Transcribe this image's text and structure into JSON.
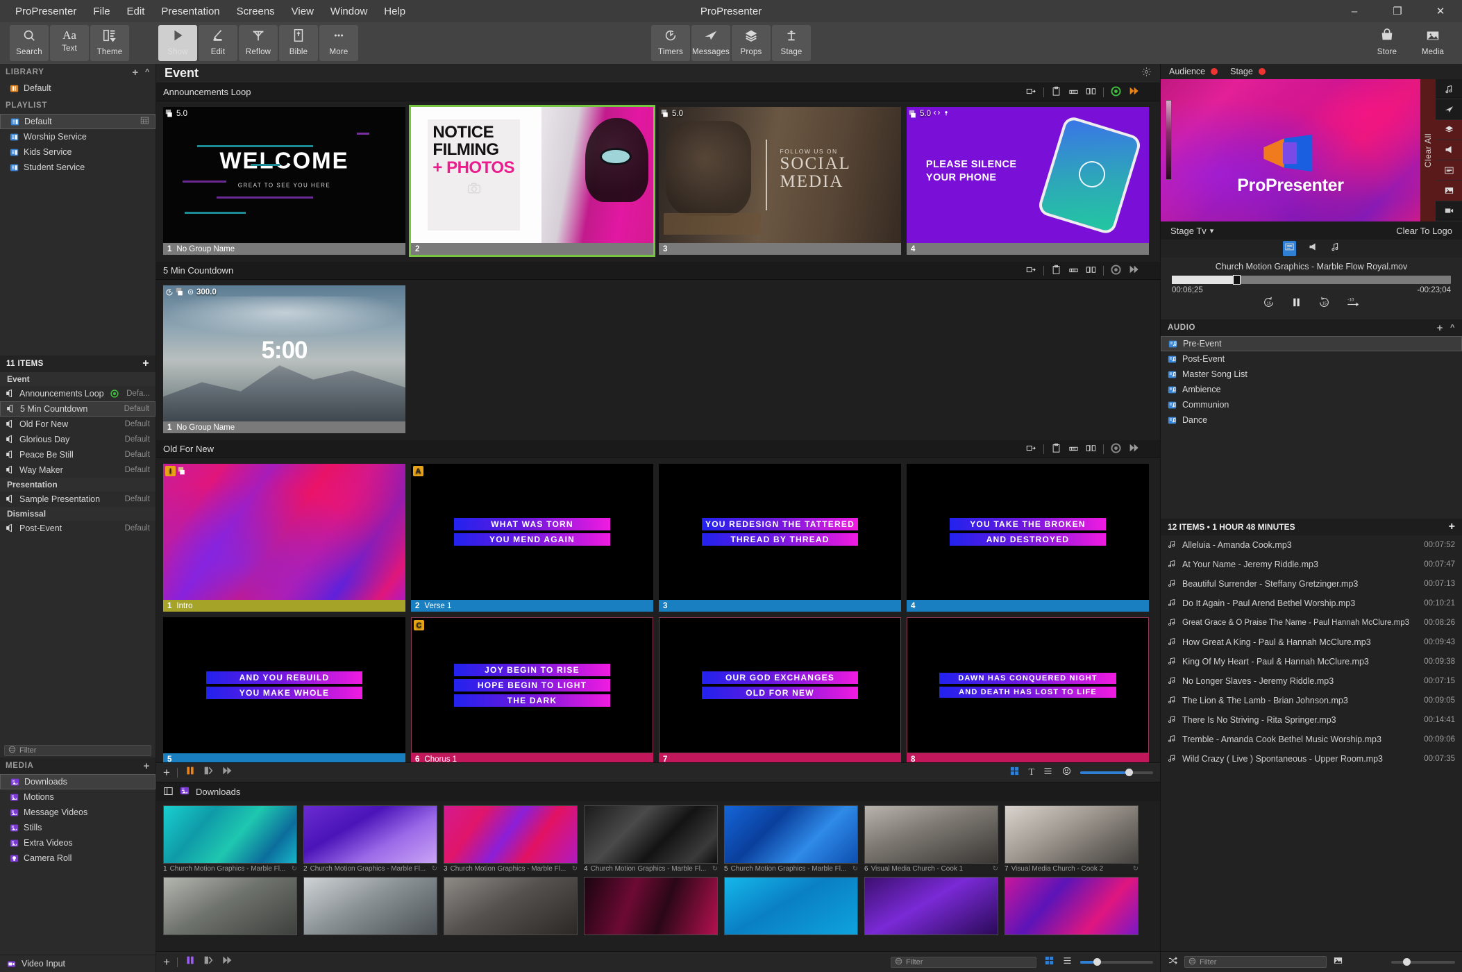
{
  "window": {
    "title": "ProPresenter",
    "menus": [
      "ProPresenter",
      "File",
      "Edit",
      "Presentation",
      "Screens",
      "View",
      "Window",
      "Help"
    ],
    "controls": {
      "minimize": "–",
      "maximize": "❐",
      "close": "✕"
    }
  },
  "toolbar": {
    "left": [
      {
        "label": "Search",
        "icon": "search-icon"
      },
      {
        "label": "Text",
        "icon": "text-icon"
      },
      {
        "label": "Theme",
        "icon": "theme-icon"
      }
    ],
    "middle": [
      {
        "label": "Show",
        "icon": "play-icon",
        "active": true
      },
      {
        "label": "Edit",
        "icon": "pencil-icon"
      },
      {
        "label": "Reflow",
        "icon": "reflow-icon"
      },
      {
        "label": "Bible",
        "icon": "bible-icon"
      },
      {
        "label": "More",
        "icon": "ellipsis-icon"
      }
    ],
    "right_group": [
      {
        "label": "Timers",
        "icon": "timer-icon"
      },
      {
        "label": "Messages",
        "icon": "send-icon"
      },
      {
        "label": "Props",
        "icon": "layers-icon"
      },
      {
        "label": "Stage",
        "icon": "stage-icon"
      }
    ],
    "far_right": [
      {
        "label": "Store",
        "icon": "store-icon"
      },
      {
        "label": "Media",
        "icon": "media-icon"
      }
    ]
  },
  "sidebar": {
    "library": {
      "title": "LIBRARY",
      "items": [
        {
          "label": "Default",
          "icon": "library-icon"
        }
      ]
    },
    "playlist": {
      "title": "PLAYLIST",
      "items": [
        {
          "label": "Default",
          "icon": "playlist-icon",
          "selected": true,
          "trailing_icon": "grid-icon"
        },
        {
          "label": "Worship Service",
          "icon": "playlist-icon"
        },
        {
          "label": "Kids Service",
          "icon": "playlist-icon"
        },
        {
          "label": "Student Service",
          "icon": "playlist-icon"
        }
      ]
    },
    "filter_placeholder": "Filter",
    "items_header": "11 ITEMS",
    "groups": [
      {
        "name": "Event",
        "items": [
          {
            "label": "Announcements Loop",
            "theme": "Defa...",
            "live": true
          },
          {
            "label": "5 Min Countdown",
            "theme": "Default",
            "selected": true
          },
          {
            "label": "Old For New",
            "theme": "Default"
          },
          {
            "label": "Glorious Day",
            "theme": "Default"
          },
          {
            "label": "Peace Be Still",
            "theme": "Default"
          },
          {
            "label": "Way Maker",
            "theme": "Default"
          }
        ]
      },
      {
        "name": "Presentation",
        "items": [
          {
            "label": "Sample Presentation",
            "theme": "Default"
          }
        ]
      },
      {
        "name": "Dismissal",
        "items": [
          {
            "label": "Post-Event",
            "theme": "Default"
          }
        ]
      }
    ],
    "media": {
      "title": "MEDIA",
      "items": [
        {
          "label": "Downloads",
          "icon": "media-folder-icon",
          "selected": true
        },
        {
          "label": "Motions",
          "icon": "media-folder-icon"
        },
        {
          "label": "Message Videos",
          "icon": "media-folder-icon"
        },
        {
          "label": "Stills",
          "icon": "media-folder-icon"
        },
        {
          "label": "Extra Videos",
          "icon": "media-folder-icon"
        },
        {
          "label": "Camera Roll",
          "icon": "camera-roll-icon"
        }
      ]
    },
    "video_input": "Video Input"
  },
  "main": {
    "title": "Event",
    "presentations": [
      {
        "name": "Announcements Loop",
        "slides": [
          {
            "num": "1",
            "label": "No Group Name",
            "timer": "5.0",
            "kind": "welcome",
            "foot_color": "#7a7a7a"
          },
          {
            "num": "2",
            "label": "",
            "kind": "notice",
            "selected": true,
            "foot_color": "#7a7a7a",
            "text": {
              "l1": "NOTICE",
              "l2": "FILMING",
              "l3": "+ PHOTOS"
            }
          },
          {
            "num": "3",
            "label": "",
            "timer": "5.0",
            "kind": "social",
            "foot_color": "#7a7a7a",
            "text": {
              "l1": "FOLLOW US ON",
              "l2": "SOCIAL",
              "l3": "MEDIA"
            }
          },
          {
            "num": "4",
            "label": "",
            "timer": "5.0",
            "kind": "phone",
            "foot_color": "#7a7a7a",
            "text": {
              "l1": "PLEASE SILENCE",
              "l2": "YOUR PHONE"
            }
          }
        ]
      },
      {
        "name": "5 Min Countdown",
        "slides": [
          {
            "num": "1",
            "label": "No Group Name",
            "timer": "300.0",
            "kind": "countdown",
            "countdown": "5:00",
            "foot_color": "#7a7a7a"
          }
        ]
      },
      {
        "name": "Old For New",
        "slides": [
          {
            "num": "1",
            "label": "Intro",
            "group": "I",
            "kind": "marble",
            "foot_color": "#a5a428"
          },
          {
            "num": "2",
            "label": "Verse 1",
            "group": "A",
            "kind": "lyric",
            "foot_color": "#1a7fc1",
            "lines": [
              "WHAT WAS TORN",
              "YOU MEND AGAIN"
            ]
          },
          {
            "num": "3",
            "label": "",
            "kind": "lyric",
            "foot_color": "#1a7fc1",
            "lines": [
              "YOU REDESIGN THE TATTERED",
              "THREAD BY THREAD"
            ]
          },
          {
            "num": "4",
            "label": "",
            "kind": "lyric",
            "foot_color": "#1a7fc1",
            "lines": [
              "YOU TAKE THE BROKEN",
              "AND DESTROYED"
            ]
          },
          {
            "num": "5",
            "label": "",
            "kind": "lyric",
            "foot_color": "#1a7fc1",
            "lines": [
              "AND YOU REBUILD",
              "YOU MAKE WHOLE"
            ]
          },
          {
            "num": "6",
            "label": "Chorus 1",
            "group": "C",
            "kind": "lyric",
            "foot_color": "#c2185b",
            "lines": [
              "JOY BEGIN TO RISE",
              "HOPE BEGIN TO LIGHT",
              "THE DARK"
            ]
          },
          {
            "num": "7",
            "label": "",
            "kind": "lyric",
            "foot_color": "#c2185b",
            "lines": [
              "OUR GOD EXCHANGES",
              "OLD FOR NEW"
            ]
          },
          {
            "num": "8",
            "label": "",
            "kind": "lyric",
            "foot_color": "#c2185b",
            "lines": [
              "DAWN HAS CONQUERED NIGHT",
              "AND DEATH HAS LOST TO LIFE"
            ]
          }
        ]
      }
    ]
  },
  "media_browser": {
    "folder": "Downloads",
    "filter_placeholder": "Filter",
    "row1": [
      {
        "num": "1",
        "name": "Church Motion Graphics - Marble Fl..."
      },
      {
        "num": "2",
        "name": "Church Motion Graphics - Marble Fl..."
      },
      {
        "num": "3",
        "name": "Church Motion Graphics - Marble Fl..."
      },
      {
        "num": "4",
        "name": "Church Motion Graphics - Marble Fl..."
      },
      {
        "num": "5",
        "name": "Church Motion Graphics - Marble Fl..."
      },
      {
        "num": "6",
        "name": "Visual Media Church - Cook 1"
      },
      {
        "num": "7",
        "name": "Visual Media Church - Cook 2"
      }
    ]
  },
  "right": {
    "tabs": [
      {
        "label": "Audience",
        "status": "#e33"
      },
      {
        "label": "Stage",
        "status": "#e33"
      }
    ],
    "clear_all": "Clear All",
    "preview_logo": "ProPresenter",
    "stage_select": "Stage Tv",
    "clear_to_logo": "Clear To Logo",
    "player": {
      "name": "Church Motion Graphics - Marble Flow Royal.mov",
      "elapsed": "00:06;25",
      "remaining": "-00:23;04",
      "back_label": "15",
      "fwd_label": "15",
      "skip_label": "-10"
    },
    "audio": {
      "title": "AUDIO",
      "items": [
        {
          "label": "Pre-Event",
          "selected": true
        },
        {
          "label": "Post-Event"
        },
        {
          "label": "Master Song List"
        },
        {
          "label": "Ambience"
        },
        {
          "label": "Communion"
        },
        {
          "label": "Dance"
        }
      ]
    },
    "tracks_header": "12 ITEMS • 1 HOUR 48 MINUTES",
    "tracks": [
      {
        "name": "Alleluia - Amanda Cook.mp3",
        "dur": "00:07:52"
      },
      {
        "name": "At Your Name - Jeremy Riddle.mp3",
        "dur": "00:07:47"
      },
      {
        "name": "Beautiful Surrender - Steffany Gretzinger.mp3",
        "dur": "00:07:13"
      },
      {
        "name": "Do It Again - Paul Arend  Bethel Worship.mp3",
        "dur": "00:10:21"
      },
      {
        "name": "Great Grace & O Praise The Name - Paul  Hannah McClure.mp3",
        "dur": "00:08:26"
      },
      {
        "name": "How Great A King - Paul & Hannah McClure.mp3",
        "dur": "00:09:43"
      },
      {
        "name": "King Of My Heart - Paul & Hannah McClure.mp3",
        "dur": "00:09:38"
      },
      {
        "name": "No Longer Slaves - Jeremy Riddle.mp3",
        "dur": "00:07:15"
      },
      {
        "name": "The Lion & The Lamb - Brian Johnson.mp3",
        "dur": "00:09:05"
      },
      {
        "name": "There Is No Striving - Rita Springer.mp3",
        "dur": "00:14:41"
      },
      {
        "name": "Tremble - Amanda Cook  Bethel Music Worship.mp3",
        "dur": "00:09:06"
      },
      {
        "name": "Wild  Crazy ( Live )  Spontaneous  - Upper Room.mp3",
        "dur": "00:07:35"
      }
    ],
    "filter_placeholder": "Filter"
  },
  "colors": {
    "accent": "#2f7fd4",
    "live": "#3ec13e",
    "select_outline": "#76c442",
    "orange": "#e8831a"
  }
}
